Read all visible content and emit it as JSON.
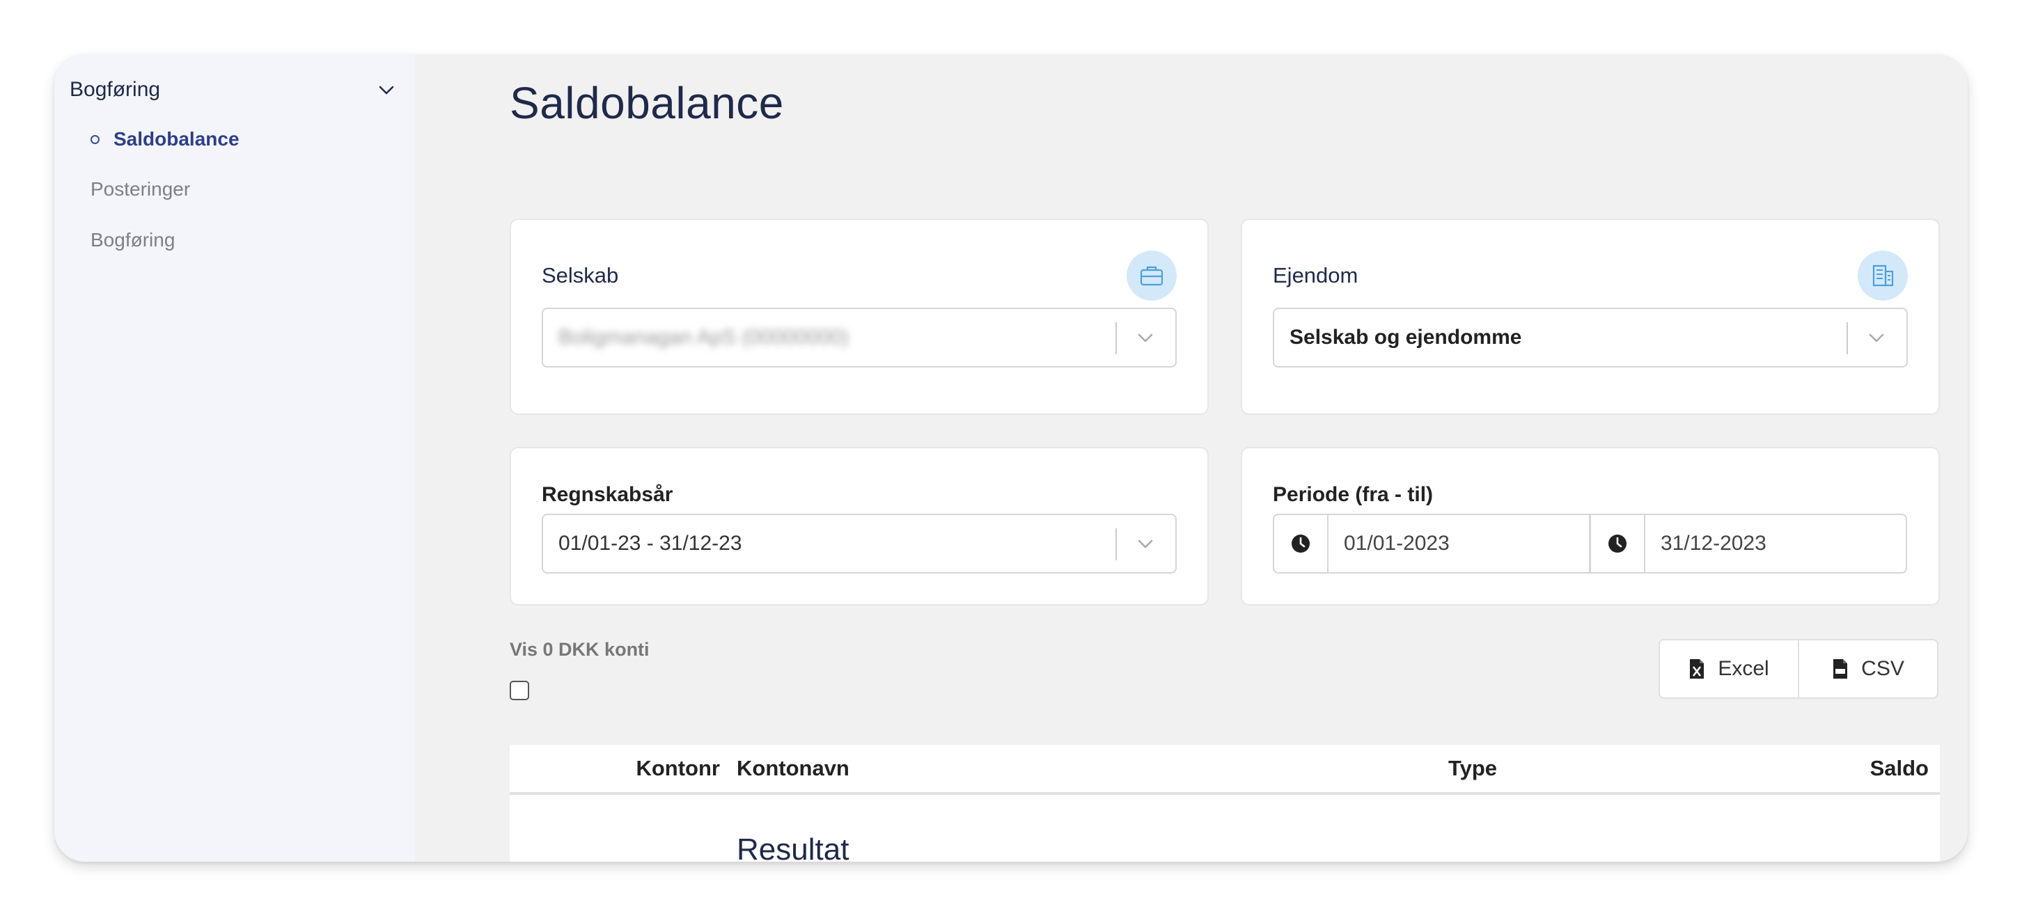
{
  "sidebar": {
    "group_label": "Bogføring",
    "items": [
      {
        "label": "Saldobalance",
        "active": true
      },
      {
        "label": "Posteringer",
        "active": false
      },
      {
        "label": "Bogføring",
        "active": false
      }
    ]
  },
  "page": {
    "title": "Saldobalance"
  },
  "filters": {
    "company": {
      "label": "Selskab",
      "value": "Boligmanagan ApS (00000000)",
      "icon": "briefcase-icon"
    },
    "property": {
      "label": "Ejendom",
      "value": "Selskab og ejendomme",
      "icon": "building-icon"
    },
    "fiscal_year": {
      "label": "Regnskabsår",
      "value": "01/01-23 - 31/12-23"
    },
    "period": {
      "label": "Periode (fra - til)",
      "from": "01/01-2023",
      "to": "31/12-2023",
      "icon": "clock-icon"
    }
  },
  "options": {
    "show_zero_label": "Vis 0 DKK konti",
    "show_zero_checked": false
  },
  "export": {
    "excel_label": "Excel",
    "csv_label": "CSV"
  },
  "table": {
    "columns": {
      "account_no": "Kontonr",
      "account_name": "Kontonavn",
      "type": "Type",
      "balance": "Saldo"
    },
    "sections": [
      {
        "title": "Resultat"
      }
    ]
  },
  "colors": {
    "accent": "#2f3f86",
    "title": "#1f2a4a",
    "icon_badge": "#d3e9fa",
    "icon_stroke": "#4a9fdc"
  }
}
